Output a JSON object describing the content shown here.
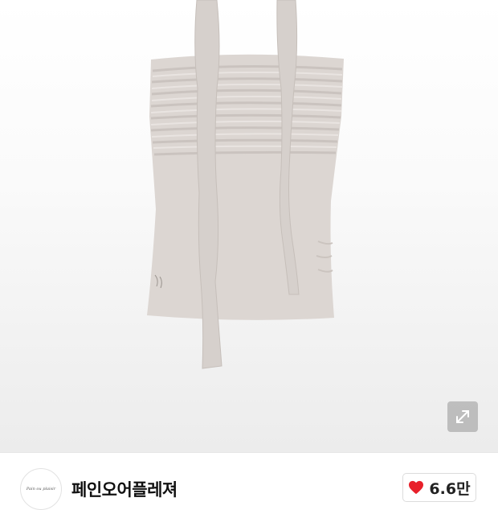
{
  "product": {
    "image_alt": "beige ruched halter top with long neck ties",
    "background_color": "#f4f4f4",
    "garment_color": "#dcd6d2"
  },
  "controls": {
    "expand_icon": "expand-arrows-icon"
  },
  "seller": {
    "avatar_logo": "Pain ou plaisir",
    "name": "페인오어플레져"
  },
  "like": {
    "icon": "heart-icon",
    "count": "6.6만",
    "heart_color": "#e8202a"
  }
}
